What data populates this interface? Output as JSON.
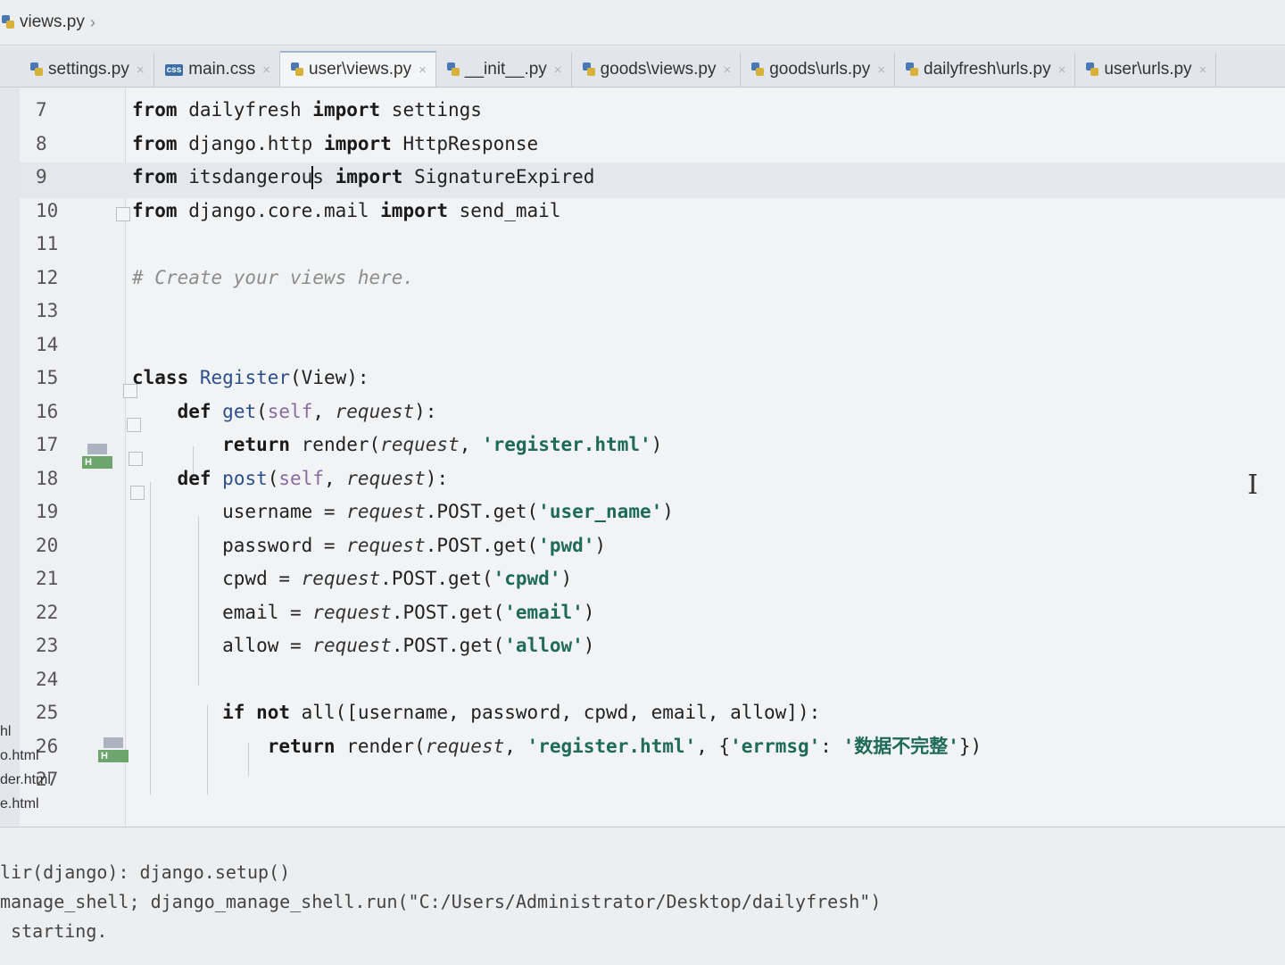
{
  "breadcrumb": {
    "file": "views.py"
  },
  "tabs": [
    {
      "label": "settings.py",
      "icon": "python-file-icon",
      "active": false
    },
    {
      "label": "main.css",
      "icon": "css-file-icon",
      "active": false
    },
    {
      "label": "user\\views.py",
      "icon": "python-file-icon",
      "active": true
    },
    {
      "label": "__init__.py",
      "icon": "python-file-icon",
      "active": false
    },
    {
      "label": "goods\\views.py",
      "icon": "python-file-icon",
      "active": false
    },
    {
      "label": "goods\\urls.py",
      "icon": "python-file-icon",
      "active": false
    },
    {
      "label": "dailyfresh\\urls.py",
      "icon": "python-file-icon",
      "active": false
    },
    {
      "label": "user\\urls.py",
      "icon": "python-file-icon",
      "active": false
    }
  ],
  "editor": {
    "current_line": 9,
    "lines": [
      {
        "n": "7",
        "t": [
          [
            "kw",
            "from"
          ],
          [
            "p",
            " dailyfresh "
          ],
          [
            "kw",
            "import"
          ],
          [
            "p",
            " settings"
          ]
        ]
      },
      {
        "n": "8",
        "t": [
          [
            "kw",
            "from"
          ],
          [
            "p",
            " django.http "
          ],
          [
            "kw",
            "import"
          ],
          [
            "p",
            " HttpResponse"
          ]
        ]
      },
      {
        "n": "9",
        "t": [
          [
            "kw",
            "from"
          ],
          [
            "p",
            " itsdangerou"
          ],
          [
            "caret",
            ""
          ],
          [
            "p",
            "s "
          ],
          [
            "kw",
            "import"
          ],
          [
            "p",
            " SignatureExpired"
          ]
        ]
      },
      {
        "n": "10",
        "t": [
          [
            "kw",
            "from"
          ],
          [
            "p",
            " django.core.mail "
          ],
          [
            "kw",
            "import"
          ],
          [
            "p",
            " send_mail"
          ]
        ]
      },
      {
        "n": "11",
        "t": []
      },
      {
        "n": "12",
        "t": [
          [
            "cmt",
            "# Create your views here."
          ]
        ]
      },
      {
        "n": "13",
        "t": []
      },
      {
        "n": "14",
        "t": []
      },
      {
        "n": "15",
        "t": [
          [
            "kw",
            "class"
          ],
          [
            "p",
            " "
          ],
          [
            "fn",
            "Register"
          ],
          [
            "p",
            "(View):"
          ]
        ]
      },
      {
        "n": "16",
        "t": [
          [
            "p",
            "    "
          ],
          [
            "kw",
            "def"
          ],
          [
            "p",
            " "
          ],
          [
            "fn",
            "get"
          ],
          [
            "p",
            "("
          ],
          [
            "self",
            "self"
          ],
          [
            "p",
            ", "
          ],
          [
            "it",
            "request"
          ],
          [
            "p",
            "):"
          ]
        ]
      },
      {
        "n": "17",
        "t": [
          [
            "p",
            "        "
          ],
          [
            "kw",
            "return"
          ],
          [
            "p",
            " render("
          ],
          [
            "it",
            "request"
          ],
          [
            "p",
            ", "
          ],
          [
            "str",
            "'register.html'"
          ],
          [
            "p",
            ")"
          ]
        ]
      },
      {
        "n": "18",
        "t": [
          [
            "p",
            "    "
          ],
          [
            "kw",
            "def"
          ],
          [
            "p",
            " "
          ],
          [
            "fn",
            "post"
          ],
          [
            "p",
            "("
          ],
          [
            "self",
            "self"
          ],
          [
            "p",
            ", "
          ],
          [
            "it",
            "request"
          ],
          [
            "p",
            "):"
          ]
        ]
      },
      {
        "n": "19",
        "t": [
          [
            "p",
            "        username = "
          ],
          [
            "it",
            "request"
          ],
          [
            "p",
            ".POST.get("
          ],
          [
            "str",
            "'user_name'"
          ],
          [
            "p",
            ")"
          ]
        ]
      },
      {
        "n": "20",
        "t": [
          [
            "p",
            "        password = "
          ],
          [
            "it",
            "request"
          ],
          [
            "p",
            ".POST.get("
          ],
          [
            "str",
            "'pwd'"
          ],
          [
            "p",
            ")"
          ]
        ]
      },
      {
        "n": "21",
        "t": [
          [
            "p",
            "        cpwd = "
          ],
          [
            "it",
            "request"
          ],
          [
            "p",
            ".POST.get("
          ],
          [
            "str",
            "'cpwd'"
          ],
          [
            "p",
            ")"
          ]
        ]
      },
      {
        "n": "22",
        "t": [
          [
            "p",
            "        email = "
          ],
          [
            "it",
            "request"
          ],
          [
            "p",
            ".POST.get("
          ],
          [
            "str",
            "'email'"
          ],
          [
            "p",
            ")"
          ]
        ]
      },
      {
        "n": "23",
        "t": [
          [
            "p",
            "        allow = "
          ],
          [
            "it",
            "request"
          ],
          [
            "p",
            ".POST.get("
          ],
          [
            "str",
            "'allow'"
          ],
          [
            "p",
            ")"
          ]
        ]
      },
      {
        "n": "24",
        "t": []
      },
      {
        "n": "25",
        "t": [
          [
            "p",
            "        "
          ],
          [
            "kw",
            "if not"
          ],
          [
            "p",
            " all([username, password, cpwd, email, allow]):"
          ]
        ]
      },
      {
        "n": "26",
        "t": [
          [
            "p",
            "            "
          ],
          [
            "kw",
            "return"
          ],
          [
            "p",
            " render("
          ],
          [
            "it",
            "request"
          ],
          [
            "p",
            ", "
          ],
          [
            "str",
            "'register.html'"
          ],
          [
            "p",
            ", {"
          ],
          [
            "str",
            "'errmsg'"
          ],
          [
            "p",
            ": "
          ],
          [
            "str",
            "'数据不完整'"
          ],
          [
            "p",
            "})"
          ]
        ]
      },
      {
        "n": "27",
        "t": []
      }
    ]
  },
  "side_files": [
    "hl",
    "o.html",
    "der.html",
    "e.html"
  ],
  "console": {
    "lines": [
      "lir(django): django.setup()",
      "manage_shell; django_manage_shell.run(\"C:/Users/Administrator/Desktop/dailyfresh\")",
      " starting."
    ]
  },
  "colors": {
    "keyword": "#1a1a1a",
    "function": "#2b4f8c",
    "string": "#1f6b5a",
    "comment": "#8c8c8c",
    "current_line": "#e4e7ec"
  }
}
